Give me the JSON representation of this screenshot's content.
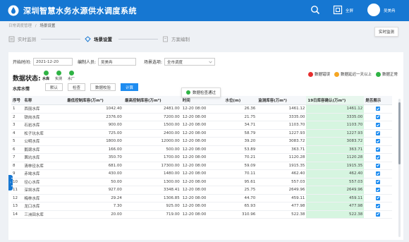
{
  "header": {
    "title": "深圳智慧水务水源供水调度系统",
    "fullscreen_label": "全屏",
    "user_name": "吴美冉"
  },
  "breadcrumb": {
    "root": "日常调度管理",
    "separator": "/",
    "current": "场景设置"
  },
  "tooltip_top": "实时监测",
  "steps": [
    {
      "label": "实时监测",
      "state": "done"
    },
    {
      "label": "场景设置",
      "state": "active"
    },
    {
      "label": "方案编制",
      "state": "pending"
    }
  ],
  "form": {
    "start_time_label": "开始时间:",
    "start_time_value": "2021-12-20",
    "editor_label": "编制人员:",
    "editor_value": "吴美冉",
    "scenario_label": "场景选项:",
    "scenario_value": "全市调度"
  },
  "status": {
    "title": "数据状态:",
    "items": [
      {
        "label": "水库",
        "bold": true
      },
      {
        "label": "实测",
        "bold": false
      },
      {
        "label": "水厂",
        "bold": false
      }
    ]
  },
  "legend": [
    {
      "label": "数据错误",
      "color": "#e62e2e"
    },
    {
      "label": "数据延迟一天以上",
      "color": "#f5a623"
    },
    {
      "label": "数据正常",
      "color": "#2fb344"
    }
  ],
  "section_label": "水库水情",
  "buttons": {
    "import": "默认",
    "check": "检查",
    "verify": "数据校验",
    "calculate": "计算"
  },
  "table": {
    "headers": [
      "序号",
      "名称",
      "最低控制库容(万m³)",
      "最高控制库容(万m³)",
      "时间",
      "水位(m)",
      "监测库容(万m³)",
      "19日库容确认(万m³)",
      "是否展示"
    ],
    "rows": [
      [
        "1",
        "西丽水库",
        "1042.40",
        "2481.00",
        "12-20 08:00",
        "26.36",
        "1461.12",
        "1461.12"
      ],
      [
        "2",
        "铁岗水库",
        "2376.00",
        "7200.00",
        "12-20 08:00",
        "21.75",
        "3335.00",
        "3335.00"
      ],
      [
        "3",
        "石岩水库",
        "900.00",
        "1500.00",
        "12-20 08:00",
        "34.71",
        "1103.70",
        "1103.70"
      ],
      [
        "4",
        "松子坑水库",
        "725.00",
        "2400.00",
        "12-20 08:00",
        "58.79",
        "1227.93",
        "1227.93"
      ],
      [
        "5",
        "公明水库",
        "1800.00",
        "12000.00",
        "12-20 08:00",
        "39.20",
        "3083.72",
        "3083.72"
      ],
      [
        "6",
        "鹅颈水库",
        "166.00",
        "500.00",
        "12-20 08:00",
        "53.89",
        "363.71",
        "363.71"
      ],
      [
        "7",
        "茜坑水库",
        "350.70",
        "1700.00",
        "12-20 08:00",
        "70.21",
        "1120.28",
        "1120.28"
      ],
      [
        "8",
        "清林径水库",
        "681.00",
        "17300.00",
        "12-20 08:00",
        "59.09",
        "1915.35",
        "1915.35"
      ],
      [
        "9",
        "赤坳水库",
        "430.00",
        "1480.00",
        "12-20 08:00",
        "70.11",
        "462.40",
        "462.40"
      ],
      [
        "10",
        "径心水库",
        "50.00",
        "1300.00",
        "12-20 08:00",
        "95.61",
        "557.03",
        "557.03"
      ],
      [
        "11",
        "深圳水库",
        "927.00",
        "3348.41",
        "12-20 08:00",
        "25.75",
        "2649.96",
        "2649.96"
      ],
      [
        "12",
        "梅林水库",
        "29.24",
        "1306.85",
        "12-20 08:00",
        "44.70",
        "459.11",
        "459.11"
      ],
      [
        "13",
        "龙口水库",
        "7.30",
        "925.00",
        "12-20 08:00",
        "65.93",
        "477.98",
        "477.98"
      ],
      [
        "14",
        "三洲田水库",
        "20.00",
        "719.00",
        "12-20 08:00",
        "310.96",
        "522.38",
        "522.38"
      ]
    ]
  },
  "pass_tip": "数据检查通过",
  "side_tab": "›"
}
